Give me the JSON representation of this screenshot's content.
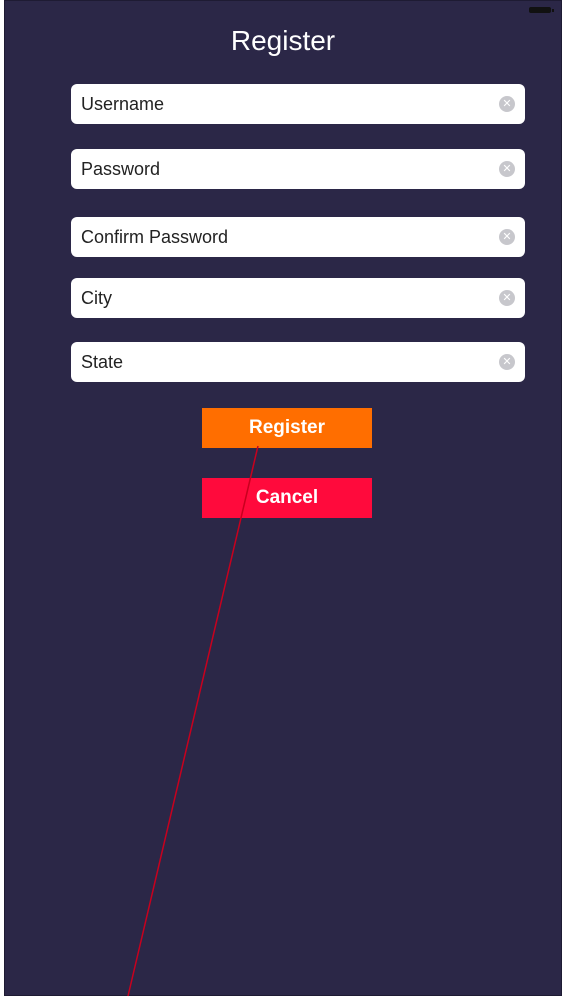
{
  "screen": {
    "title": "Register",
    "background_color": "#2b2747"
  },
  "form": {
    "fields": [
      {
        "name": "username",
        "placeholder": "Username",
        "value": "",
        "clear_icon": "clear-circle-icon"
      },
      {
        "name": "password",
        "placeholder": "Password",
        "value": "",
        "clear_icon": "clear-circle-icon"
      },
      {
        "name": "confirm_password",
        "placeholder": "Confirm Password",
        "value": "",
        "clear_icon": "clear-circle-icon"
      },
      {
        "name": "city",
        "placeholder": "City",
        "value": "",
        "clear_icon": "clear-circle-icon"
      },
      {
        "name": "state",
        "placeholder": "State",
        "value": "",
        "clear_icon": "clear-circle-icon"
      }
    ]
  },
  "buttons": {
    "register_label": "Register",
    "register_color": "#ff6e00",
    "cancel_label": "Cancel",
    "cancel_color": "#ff0a3c"
  },
  "annotation": {
    "line_color": "#c8001e"
  }
}
